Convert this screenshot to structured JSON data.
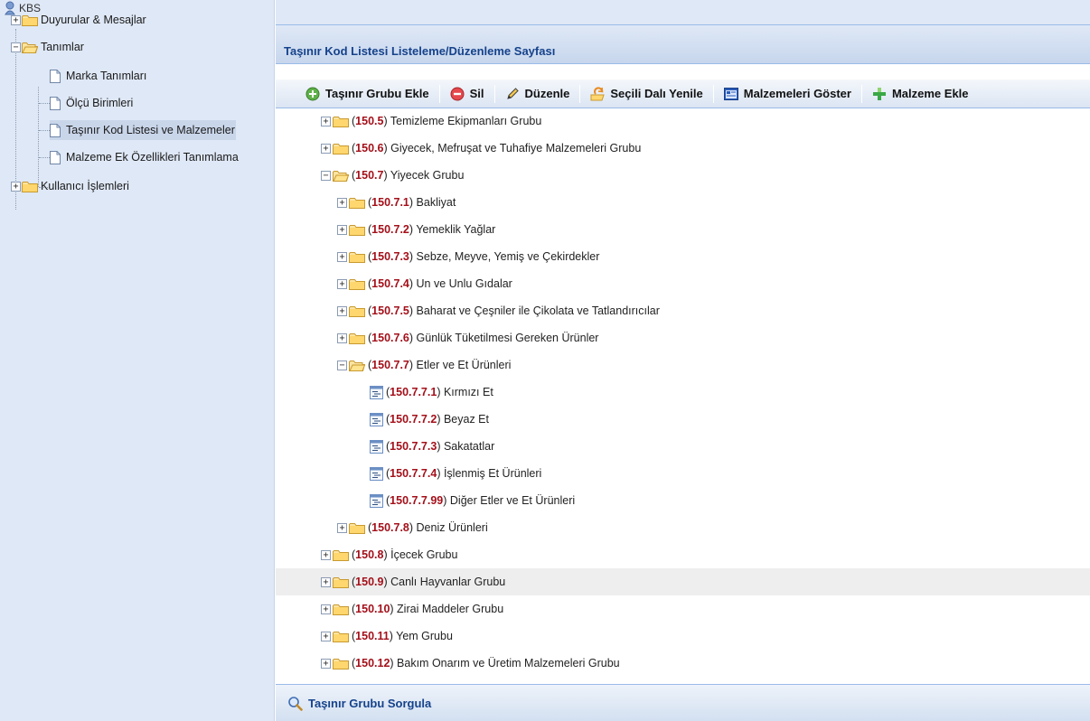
{
  "app": {
    "title": "KBS"
  },
  "nav": {
    "items": [
      {
        "label": "Duyurular & Mesajlar",
        "type": "folder",
        "level": 0,
        "expanded": false
      },
      {
        "label": "Tanımlar",
        "type": "folder",
        "level": 0,
        "expanded": true
      },
      {
        "label": "Marka Tanımları",
        "type": "page",
        "level": 1
      },
      {
        "label": "Ölçü Birimleri",
        "type": "page",
        "level": 1
      },
      {
        "label": "Taşınır Kod Listesi ve Malzemeler",
        "type": "page",
        "level": 1,
        "selected": true
      },
      {
        "label": "Malzeme Ek Özellikleri Tanımlama",
        "type": "page",
        "level": 1
      },
      {
        "label": "Kullanıcı İşlemleri",
        "type": "folder",
        "level": 0,
        "expanded": false
      }
    ]
  },
  "panel": {
    "title": "Taşınır Kod Listesi Listeleme/Düzenleme Sayfası"
  },
  "toolbar": {
    "buttons": [
      {
        "label": "Taşınır Grubu Ekle",
        "icon": "add-circle-icon"
      },
      {
        "label": "Sil",
        "icon": "delete-circle-icon"
      },
      {
        "label": "Düzenle",
        "icon": "pencil-icon"
      },
      {
        "label": "Seçili Dalı Yenile",
        "icon": "refresh-icon"
      },
      {
        "label": "Malzemeleri Göster",
        "icon": "list-window-icon"
      },
      {
        "label": "Malzeme Ekle",
        "icon": "green-plus-icon"
      }
    ]
  },
  "tree": {
    "rows": [
      {
        "code": "150.5",
        "label": "Temizleme Ekipmanları Grubu",
        "level": 0,
        "type": "folder",
        "expanded": false
      },
      {
        "code": "150.6",
        "label": "Giyecek, Mefruşat ve Tuhafiye Malzemeleri Grubu",
        "level": 0,
        "type": "folder",
        "expanded": false
      },
      {
        "code": "150.7",
        "label": "Yiyecek Grubu",
        "level": 0,
        "type": "folder",
        "expanded": true
      },
      {
        "code": "150.7.1",
        "label": "Bakliyat",
        "level": 1,
        "type": "folder",
        "expanded": false
      },
      {
        "code": "150.7.2",
        "label": "Yemeklik Yağlar",
        "level": 1,
        "type": "folder",
        "expanded": false
      },
      {
        "code": "150.7.3",
        "label": "Sebze, Meyve, Yemiş ve Çekirdekler",
        "level": 1,
        "type": "folder",
        "expanded": false
      },
      {
        "code": "150.7.4",
        "label": "Un ve Unlu Gıdalar",
        "level": 1,
        "type": "folder",
        "expanded": false
      },
      {
        "code": "150.7.5",
        "label": "Baharat ve Çeşniler ile Çikolata ve Tatlandırıcılar",
        "level": 1,
        "type": "folder",
        "expanded": false
      },
      {
        "code": "150.7.6",
        "label": "Günlük Tüketilmesi Gereken Ürünler",
        "level": 1,
        "type": "folder",
        "expanded": false
      },
      {
        "code": "150.7.7",
        "label": "Etler ve Et Ürünleri",
        "level": 1,
        "type": "folder",
        "expanded": true
      },
      {
        "code": "150.7.7.1",
        "label": "Kırmızı Et",
        "level": 2,
        "type": "leaf"
      },
      {
        "code": "150.7.7.2",
        "label": "Beyaz Et",
        "level": 2,
        "type": "leaf"
      },
      {
        "code": "150.7.7.3",
        "label": "Sakatatlar",
        "level": 2,
        "type": "leaf"
      },
      {
        "code": "150.7.7.4",
        "label": "İşlenmiş Et Ürünleri",
        "level": 2,
        "type": "leaf"
      },
      {
        "code": "150.7.7.99",
        "label": "Diğer Etler ve Et Ürünleri",
        "level": 2,
        "type": "leaf"
      },
      {
        "code": "150.7.8",
        "label": "Deniz Ürünleri",
        "level": 1,
        "type": "folder",
        "expanded": false
      },
      {
        "code": "150.8",
        "label": "İçecek Grubu",
        "level": 0,
        "type": "folder",
        "expanded": false
      },
      {
        "code": "150.9",
        "label": "Canlı Hayvanlar Grubu",
        "level": 0,
        "type": "folder",
        "expanded": false,
        "hover": true
      },
      {
        "code": "150.10",
        "label": "Zirai Maddeler Grubu",
        "level": 0,
        "type": "folder",
        "expanded": false
      },
      {
        "code": "150.11",
        "label": "Yem Grubu",
        "level": 0,
        "type": "folder",
        "expanded": false
      },
      {
        "code": "150.12",
        "label": "Bakım Onarım ve Üretim Malzemeleri Grubu",
        "level": 0,
        "type": "folder",
        "expanded": false
      }
    ]
  },
  "footer": {
    "label": "Taşınır Grubu Sorgula",
    "icon": "magnifier-icon"
  },
  "colors": {
    "code": "#a4101a",
    "header_text": "#15428b",
    "nav_bg": "#dfe8f6",
    "border": "#99bbe8"
  }
}
